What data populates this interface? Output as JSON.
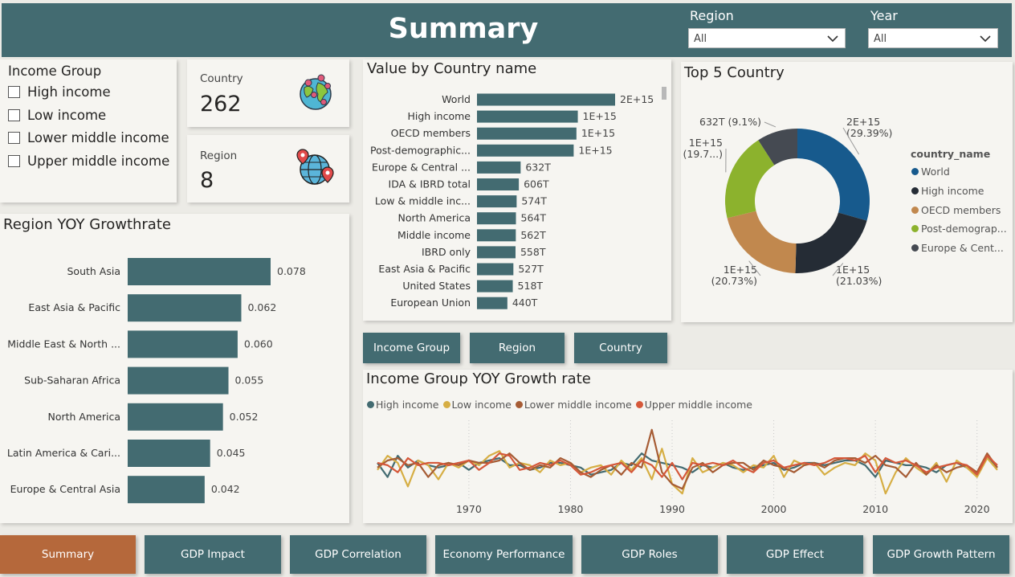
{
  "header": {
    "title": "Summary",
    "region_label": "Region",
    "region_value": "All",
    "year_label": "Year",
    "year_value": "All"
  },
  "income_group": {
    "title": "Income Group",
    "options": [
      "High income",
      "Low income",
      "Lower middle income",
      "Upper middle income"
    ]
  },
  "kpis": {
    "country_label": "Country",
    "country_value": "262",
    "region_label": "Region",
    "region_value": "8"
  },
  "icons": [
    "globe-pins-icon",
    "globe-location-icon",
    "chevron-down-icon"
  ],
  "colors": {
    "primary": "#436b71",
    "active_nav": "#b5683b",
    "world": "#175a8d",
    "high_income": "#252c35",
    "oecd": "#c1884e",
    "post_demographic": "#8cb22d",
    "europe": "#454a52",
    "line_high": "#436b71",
    "line_low": "#d6ae44",
    "line_lower_middle": "#a65c35",
    "line_upper_middle": "#d5583a"
  },
  "value_by_country": {
    "title": "Value by Country name",
    "chart_data": {
      "type": "bar",
      "orientation": "horizontal",
      "categories": [
        "World",
        "High income",
        "OECD members",
        "Post-demographic...",
        "Europe & Central ...",
        "IDA & IBRD total",
        "Low & middle inc...",
        "North America",
        "Middle income",
        "IBRD only",
        "East Asia & Pacific",
        "United States",
        "European Union"
      ],
      "values": [
        2000,
        1460,
        1440,
        1400,
        632,
        606,
        574,
        564,
        562,
        558,
        527,
        518,
        440
      ],
      "value_unit": "T",
      "data_labels": [
        "2E+15",
        "1E+15",
        "1E+15",
        "1E+15",
        "632T",
        "606T",
        "574T",
        "564T",
        "562T",
        "558T",
        "527T",
        "518T",
        "440T"
      ]
    }
  },
  "top5": {
    "title": "Top 5 Country",
    "legend_title": "country_name",
    "chart_data": {
      "type": "pie",
      "variant": "donut",
      "labels": [
        "World",
        "High income",
        "OECD members",
        "Post-demograp...",
        "Europe & Cent..."
      ],
      "values": [
        29.39,
        21.03,
        20.73,
        19.7,
        9.1
      ],
      "data_labels": [
        [
          "2E+15",
          "(29.39%)"
        ],
        [
          "1E+15",
          "(21.03%)"
        ],
        [
          "1E+15",
          "(20.73%)"
        ],
        [
          "1E+15",
          "(19.7...)"
        ],
        [
          "632T (9.1%)"
        ]
      ]
    }
  },
  "region_yoy": {
    "title": "Region YOY Growthrate",
    "chart_data": {
      "type": "bar",
      "orientation": "horizontal",
      "categories": [
        "South Asia",
        "East Asia & Pacific",
        "Middle East & North ...",
        "Sub-Saharan Africa",
        "North America",
        "Latin America & Cari...",
        "Europe & Central Asia"
      ],
      "values": [
        0.078,
        0.062,
        0.06,
        0.055,
        0.052,
        0.045,
        0.042
      ],
      "data_labels": [
        "0.078",
        "0.062",
        "0.060",
        "0.055",
        "0.052",
        "0.045",
        "0.042"
      ]
    }
  },
  "toggle_buttons": [
    "Income Group",
    "Region",
    "Country"
  ],
  "income_yoy": {
    "title": "Income Group YOY Growth rate",
    "chart_data": {
      "type": "line",
      "x_ticks": [
        "1970",
        "1980",
        "1990",
        "2000",
        "2010",
        "2020"
      ],
      "x_range": [
        1961,
        2022
      ],
      "y_range": [
        -0.14,
        0.2
      ],
      "grid": "vertical dotted",
      "series": [
        {
          "name": "High income",
          "values": [
            0.02,
            -0.04,
            0.05,
            0.0,
            0.03,
            0.01,
            0.0,
            0.01,
            0.02,
            -0.01,
            0.02,
            0.03,
            0.04,
            0.01,
            0.01,
            -0.01,
            0.0,
            0.02,
            0.02,
            0.01,
            0.0,
            -0.03,
            -0.02,
            -0.01,
            0.02,
            0.01,
            0.06,
            0.03,
            0.02,
            0.01,
            0.0,
            -0.02,
            0.01,
            0.0,
            0.02,
            0.0,
            -0.01,
            0.0,
            0.01,
            0.02,
            -0.01,
            0.0,
            0.02,
            0.02,
            0.01,
            0.02,
            0.03,
            0.03,
            0.01,
            -0.04,
            0.03,
            0.02,
            0.01,
            0.01,
            0.0,
            -0.02,
            0.01,
            0.02,
            0.0,
            -0.03,
            0.05,
            0.0
          ]
        },
        {
          "name": "Low income",
          "values": [
            -0.01,
            0.05,
            0.02,
            -0.08,
            0.03,
            0.01,
            -0.05,
            0.02,
            0.0,
            0.03,
            0.01,
            0.05,
            0.07,
            0.0,
            0.02,
            0.01,
            -0.02,
            0.03,
            0.01,
            0.02,
            -0.02,
            0.0,
            0.01,
            -0.03,
            0.03,
            -0.01,
            0.04,
            -0.05,
            0.08,
            -0.07,
            -0.11,
            0.04,
            -0.02,
            0.0,
            0.02,
            0.01,
            -0.02,
            0.01,
            0.0,
            0.05,
            -0.04,
            0.03,
            0.01,
            0.02,
            -0.03,
            0.0,
            0.02,
            0.01,
            0.06,
            0.03,
            -0.11,
            -0.02,
            0.04,
            0.0,
            -0.03,
            0.02,
            -0.06,
            0.03,
            0.0,
            -0.04,
            0.04,
            -0.01
          ]
        },
        {
          "name": "Lower middle income",
          "values": [
            0.0,
            0.03,
            0.04,
            0.01,
            0.02,
            -0.04,
            0.01,
            0.02,
            0.01,
            0.03,
            0.02,
            0.02,
            0.03,
            0.06,
            0.02,
            -0.01,
            0.01,
            0.0,
            0.04,
            0.02,
            -0.02,
            -0.04,
            -0.01,
            0.01,
            -0.03,
            0.02,
            0.0,
            0.16,
            -0.02,
            -0.07,
            -0.09,
            0.0,
            0.02,
            -0.02,
            0.01,
            0.02,
            0.02,
            -0.01,
            0.03,
            0.01,
            0.0,
            -0.02,
            0.01,
            0.02,
            0.0,
            0.03,
            0.04,
            0.04,
            0.02,
            0.05,
            0.01,
            0.0,
            -0.04,
            0.02,
            -0.03,
            0.01,
            -0.02,
            0.0,
            0.01,
            -0.02,
            0.06,
            0.0
          ]
        },
        {
          "name": "Upper middle income",
          "values": [
            0.02,
            0.01,
            -0.02,
            0.04,
            0.01,
            0.02,
            0.02,
            0.01,
            0.02,
            0.03,
            -0.01,
            0.02,
            0.06,
            0.05,
            -0.01,
            0.0,
            0.02,
            0.01,
            0.03,
            0.01,
            -0.03,
            -0.02,
            0.0,
            0.01,
            0.02,
            -0.02,
            0.03,
            0.01,
            -0.04,
            0.02,
            -0.05,
            0.02,
            0.01,
            0.02,
            0.01,
            0.03,
            0.0,
            -0.02,
            0.02,
            0.03,
            0.0,
            0.01,
            0.02,
            0.01,
            0.02,
            0.04,
            0.04,
            0.03,
            0.05,
            -0.02,
            0.04,
            0.02,
            0.03,
            0.01,
            -0.02,
            0.0,
            0.01,
            0.02,
            0.01,
            -0.03,
            0.05,
            0.01
          ]
        }
      ]
    }
  },
  "nav": {
    "items": [
      "Summary",
      "GDP Impact",
      "GDP Correlation",
      "Economy Performance",
      "GDP Roles",
      "GDP Effect",
      "GDP Growth Pattern"
    ],
    "active": "Summary"
  }
}
